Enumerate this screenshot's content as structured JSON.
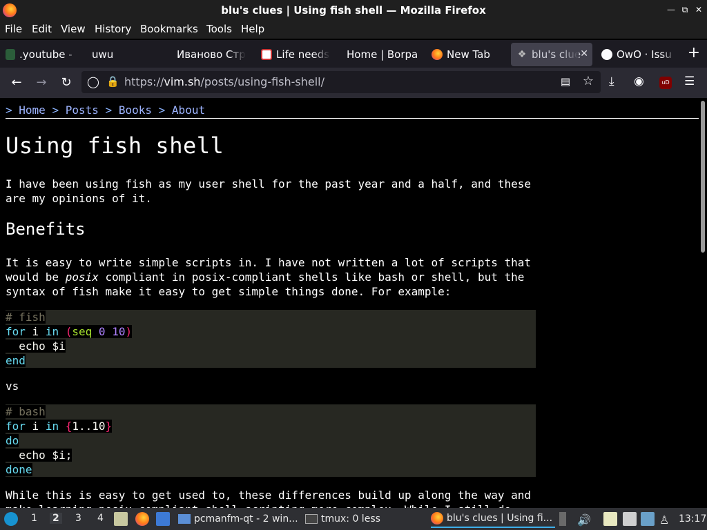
{
  "window": {
    "title": "blu's clues | Using fish shell — Mozilla Firefox"
  },
  "menu": [
    "File",
    "Edit",
    "View",
    "History",
    "Bookmarks",
    "Tools",
    "Help"
  ],
  "tabs": [
    {
      "label": ".youtube -",
      "icon": "youtube-icon"
    },
    {
      "label": "uwu",
      "icon": ""
    },
    {
      "label": "Иваново Стр",
      "icon": ""
    },
    {
      "label": "Life needs",
      "icon": "page-icon"
    },
    {
      "label": "Home | Borpa",
      "icon": ""
    },
    {
      "label": "New Tab",
      "icon": "firefox-icon"
    },
    {
      "label": "blu's clue",
      "icon": "bird-icon",
      "active": true
    },
    {
      "label": "OwO · Issu",
      "icon": "github-icon"
    }
  ],
  "nav": {
    "url_prefix": "https://",
    "url_domain": "vim.sh",
    "url_path": "/posts/using-fish-shell/"
  },
  "page": {
    "breadcrumb": [
      ">",
      "Home",
      ">",
      "Posts",
      ">",
      "Books",
      ">",
      "About"
    ],
    "title": "Using fish shell",
    "intro": "I have been using fish as my user shell for the past year and a half, and these are my opinions of it.",
    "benefits_heading": "Benefits",
    "benefits_p1_a": "It is easy to write simple scripts in. I have not written a lot of scripts that would be ",
    "benefits_p1_em": "posix",
    "benefits_p1_b": " compliant in posix-compliant shells like bash or shell, but the syntax of fish make it easy to get simple things done. For example:",
    "code_fish": {
      "comment": "# fish",
      "for": "for",
      "i": " i ",
      "in": "in",
      "open": "(",
      "seq": "seq",
      "n0": "0",
      "n10": "10",
      "close": ")",
      "echo": "  echo ",
      "var": "$i",
      "end": "end"
    },
    "vs": "vs",
    "code_bash": {
      "comment": "# bash",
      "for": "for",
      "i": " i ",
      "in": "in",
      "space": " ",
      "open": "{",
      "range": "1..10",
      "close": "}",
      "do": "do",
      "echo": "  echo $i;",
      "done": "done"
    },
    "closing": "While this is easy to get used to, these differences build up along the way and make learning posix compliant shell scripting more complex. While I still do"
  },
  "taskbar": {
    "desktops": [
      "1",
      "2",
      "3",
      "4"
    ],
    "tasks": [
      {
        "label": "pcmanfm-qt - 2 win...",
        "icon": "folder-icon"
      },
      {
        "label": "tmux: 0 less",
        "icon": "terminal-icon"
      },
      {
        "label": "blu's clues | Using fi...",
        "icon": "firefox-icon",
        "active": true
      }
    ],
    "clock": "13:17"
  }
}
